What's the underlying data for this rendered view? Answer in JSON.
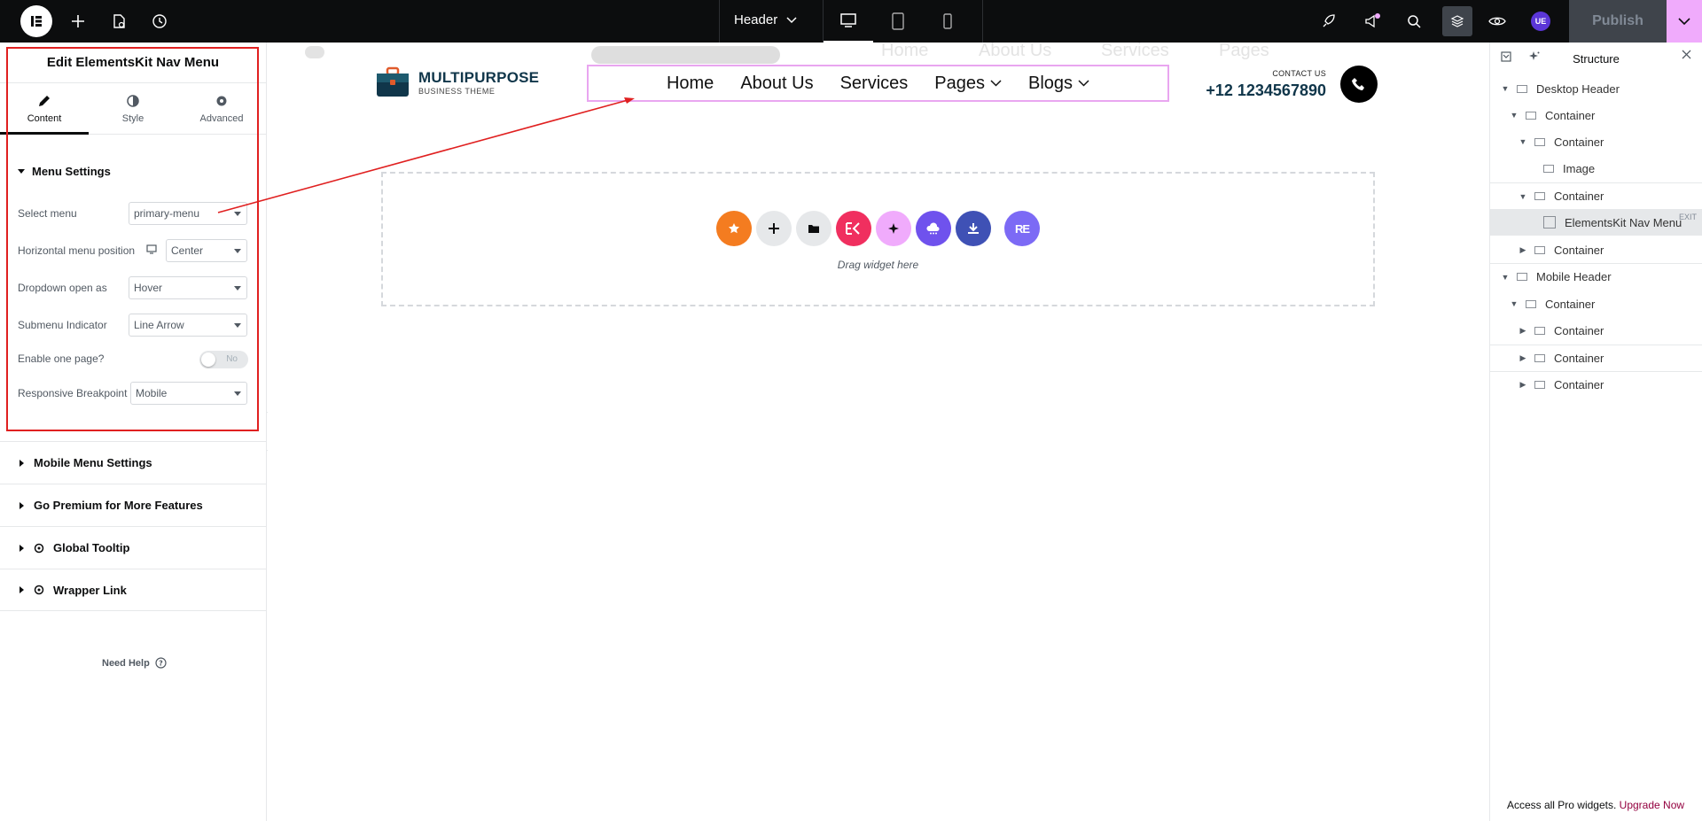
{
  "topbar": {
    "doc_title": "Header",
    "publish_label": "Publish",
    "user_badge": "UE"
  },
  "panel": {
    "title": "Edit ElementsKit Nav Menu",
    "tabs": [
      {
        "label": "Content",
        "icon": "pencil-icon",
        "active": true
      },
      {
        "label": "Style",
        "icon": "half-circle-icon",
        "active": false
      },
      {
        "label": "Advanced",
        "icon": "gear-icon",
        "active": false
      }
    ],
    "section_title": "Menu Settings",
    "controls": {
      "select_menu": {
        "label": "Select menu",
        "value": "primary-menu"
      },
      "horizontal_position": {
        "label": "Horizontal menu position",
        "value": "Center"
      },
      "dropdown_open": {
        "label": "Dropdown open as",
        "value": "Hover"
      },
      "submenu_indicator": {
        "label": "Submenu Indicator",
        "value": "Line Arrow"
      },
      "one_page": {
        "label": "Enable one page?",
        "value": "No"
      },
      "responsive_breakpoint": {
        "label": "Responsive Breakpoint",
        "value": "Mobile"
      }
    },
    "accordions": [
      "Mobile Menu Settings",
      "Go Premium for More Features",
      "Global Tooltip",
      "Wrapper Link"
    ],
    "need_help": "Need Help"
  },
  "canvas": {
    "ghost_nav": [
      "Home",
      "About Us",
      "Services",
      "Pages"
    ],
    "brand_name": "MULTIPURPOSE",
    "brand_sub": "BUSINESS THEME",
    "nav_items": [
      {
        "label": "Home",
        "has_caret": false
      },
      {
        "label": "About Us",
        "has_caret": false
      },
      {
        "label": "Services",
        "has_caret": false
      },
      {
        "label": "Pages",
        "has_caret": true
      },
      {
        "label": "Blogs",
        "has_caret": true
      }
    ],
    "contact_label": "CONTACT US",
    "contact_number": "+12 1234567890",
    "drag_text": "Drag widget here",
    "widget_buttons": [
      {
        "name": "favorite-widget-button",
        "color": "#f47c20",
        "glyph": "★"
      },
      {
        "name": "add-section-button",
        "color": "#e6e8ea",
        "glyph": "+"
      },
      {
        "name": "template-library-button",
        "color": "#e6e8ea",
        "glyph": "folder"
      },
      {
        "name": "elementskit-button",
        "color": "#f02f5f",
        "glyph": "EK"
      },
      {
        "name": "ai-button",
        "color": "#f0abfc",
        "glyph": "✦"
      },
      {
        "name": "cloud-button",
        "color": "#6f52ed",
        "glyph": "cloud"
      },
      {
        "name": "download-button",
        "color": "#3f51b5",
        "glyph": "download"
      },
      {
        "name": "royal-elementor-button",
        "color": "#7c6af5",
        "glyph": "RE"
      }
    ]
  },
  "structure": {
    "title": "Structure",
    "nodes": [
      {
        "label": "Desktop Header",
        "depth": 0,
        "arrow": "down",
        "selected": false
      },
      {
        "label": "Container",
        "depth": 1,
        "arrow": "down",
        "selected": false
      },
      {
        "label": "Container",
        "depth": 2,
        "arrow": "down",
        "selected": false
      },
      {
        "label": "Image",
        "depth": 3,
        "arrow": "",
        "selected": false
      },
      {
        "label": "Container",
        "depth": 2,
        "arrow": "down",
        "selected": false
      },
      {
        "label": "ElementsKit Nav Menu",
        "depth": 3,
        "arrow": "",
        "selected": true
      },
      {
        "label": "Container",
        "depth": 2,
        "arrow": "right",
        "selected": false
      },
      {
        "label": "Mobile Header",
        "depth": 0,
        "arrow": "down",
        "selected": false
      },
      {
        "label": "Container",
        "depth": 1,
        "arrow": "down",
        "selected": false
      },
      {
        "label": "Container",
        "depth": 2,
        "arrow": "right",
        "selected": false
      },
      {
        "label": "Container",
        "depth": 2,
        "arrow": "right",
        "selected": false
      },
      {
        "label": "Container",
        "depth": 2,
        "arrow": "right",
        "selected": false
      }
    ],
    "exit_label": "EXIT",
    "upgrade_text": "Access all Pro widgets.",
    "upgrade_link": "Upgrade Now"
  }
}
